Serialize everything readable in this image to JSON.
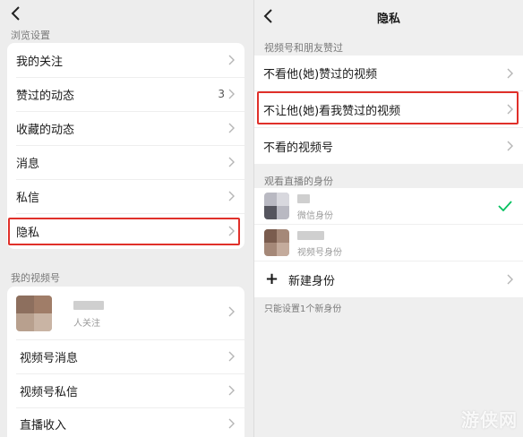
{
  "left": {
    "browse_section": "浏览设置",
    "browse_items": [
      {
        "label": "我的关注",
        "value": ""
      },
      {
        "label": "赞过的动态",
        "value": "3"
      },
      {
        "label": "收藏的动态",
        "value": ""
      },
      {
        "label": "消息",
        "value": ""
      },
      {
        "label": "私信",
        "value": ""
      },
      {
        "label": "隐私",
        "value": ""
      }
    ],
    "channel_section": "我的视频号",
    "profile_followers": "人关注",
    "channel_items": [
      {
        "label": "视频号消息"
      },
      {
        "label": "视频号私信"
      },
      {
        "label": "直播收入"
      }
    ]
  },
  "right": {
    "title": "隐私",
    "likes_section": "视频号和朋友赞过",
    "likes_items": [
      {
        "label": "不看他(她)赞过的视频"
      },
      {
        "label": "不让他(她)看我赞过的视频"
      },
      {
        "label": "不看的视频号"
      }
    ],
    "identity_section": "观看直播的身份",
    "identities": [
      {
        "sub": "微信身份",
        "selected": true
      },
      {
        "sub": "视频号身份",
        "selected": false
      }
    ],
    "new_identity": "新建身份",
    "footnote": "只能设置1个新身份"
  },
  "watermark": "游侠网",
  "colors": {
    "highlight": "#e0302a",
    "check": "#07c160"
  },
  "icons": [
    "back-arrow-icon",
    "chevron-right-icon",
    "checkmark-icon",
    "plus-icon"
  ]
}
